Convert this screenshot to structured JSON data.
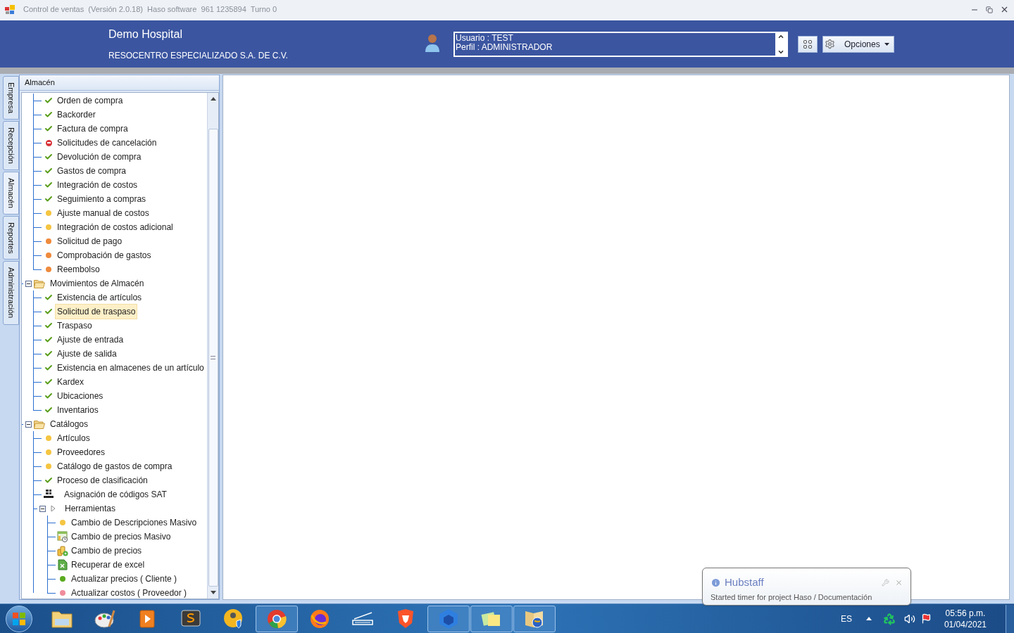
{
  "window": {
    "title": "Control de ventas  (Versión 2.0.18)  Haso software  961 1235894  Turno 0"
  },
  "header": {
    "company": "Demo Hospital",
    "subtitle": "RESOCENTRO ESPECIALIZADO S.A. DE C.V.",
    "user_lines": [
      "Usuario : TEST",
      "Perfil : ADMINISTRADOR"
    ],
    "options_button": "Opciones"
  },
  "side_tabs": [
    {
      "label": "Empresa",
      "selected": false
    },
    {
      "label": "Recepción",
      "selected": false
    },
    {
      "label": "Almacén",
      "selected": true
    },
    {
      "label": "Reportes",
      "selected": false
    },
    {
      "label": "Administración",
      "selected": false
    }
  ],
  "panel": {
    "title": "Almacén",
    "tree": [
      {
        "kind": "continued",
        "children": [
          {
            "label": "Orden de compra",
            "kind": "check",
            "selected": false
          },
          {
            "label": "Backorder",
            "kind": "check",
            "selected": false
          },
          {
            "label": "Factura de compra",
            "kind": "check",
            "selected": false
          },
          {
            "label": "Solicitudes de cancelación",
            "kind": "blocked",
            "selected": false
          },
          {
            "label": "Devolución de compra",
            "kind": "check",
            "selected": false
          },
          {
            "label": "Gastos de compra",
            "kind": "check",
            "selected": false
          },
          {
            "label": "Integración de costos",
            "kind": "check",
            "selected": false
          },
          {
            "label": "Seguimiento a compras",
            "kind": "check",
            "selected": false
          },
          {
            "label": "Ajuste manual de costos",
            "kind": "dot",
            "color": "#f5c542",
            "selected": false
          },
          {
            "label": "Integración de costos adicional",
            "kind": "dot",
            "color": "#f5c542",
            "selected": false
          },
          {
            "label": "Solicitud de pago",
            "kind": "dot",
            "color": "#ef8a3c",
            "selected": false
          },
          {
            "label": "Comprobación de gastos",
            "kind": "dot",
            "color": "#ef8a3c",
            "selected": false
          },
          {
            "label": "Reembolso",
            "kind": "dot",
            "color": "#ef8a3c",
            "selected": false
          }
        ]
      },
      {
        "kind": "folder",
        "label": "Movimientos de Almacén",
        "expanded": true,
        "children": [
          {
            "label": "Existencia de artículos",
            "kind": "check",
            "selected": false
          },
          {
            "label": "Solicitud de traspaso",
            "kind": "check",
            "selected": true
          },
          {
            "label": "Traspaso",
            "kind": "check",
            "selected": false
          },
          {
            "label": "Ajuste de entrada",
            "kind": "check",
            "selected": false
          },
          {
            "label": "Ajuste de salida",
            "kind": "check",
            "selected": false
          },
          {
            "label": "Existencia en almacenes de un artículo",
            "kind": "check",
            "selected": false
          },
          {
            "label": "Kardex",
            "kind": "check",
            "selected": false
          },
          {
            "label": "Ubicaciones",
            "kind": "check",
            "selected": false
          },
          {
            "label": "Inventarios",
            "kind": "check",
            "selected": false
          }
        ]
      },
      {
        "kind": "folder",
        "label": "Catálogos",
        "expanded": true,
        "children": [
          {
            "label": "Artículos",
            "kind": "dot",
            "color": "#f5c542",
            "selected": false
          },
          {
            "label": "Proveedores",
            "kind": "dot",
            "color": "#f5c542",
            "selected": false
          },
          {
            "label": "Catálogo de gastos de compra",
            "kind": "dot",
            "color": "#f5c542",
            "selected": false
          },
          {
            "label": "Proceso de clasificación",
            "kind": "check",
            "selected": false
          },
          {
            "label": "Asignación de códigos SAT",
            "kind": "sat",
            "selected": false
          },
          {
            "label": "Herramientas",
            "kind": "arrow",
            "expanded": true,
            "selected": false,
            "children": [
              {
                "label": "Cambio de Descripciones Masivo",
                "kind": "dot",
                "color": "#f5c542",
                "selected": false
              },
              {
                "label": "Cambio de precios Masivo",
                "kind": "calendar",
                "selected": false
              },
              {
                "label": "Cambio de precios",
                "kind": "coins",
                "selected": false
              },
              {
                "label": "Recuperar de excel",
                "kind": "sheet",
                "selected": false
              },
              {
                "label": "Actualizar precios ( Cliente )",
                "kind": "dot",
                "color": "#5aaa1e",
                "selected": false
              },
              {
                "label": "Actualizar costos ( Proveedor )",
                "kind": "dot",
                "color": "#f08c9c",
                "selected": false
              }
            ]
          }
        ]
      }
    ]
  },
  "notification": {
    "title": "Hubstaff",
    "message": "Started timer for project Haso / Documentación"
  },
  "taskbar": {
    "apps": [
      {
        "kind": "folder",
        "open": false
      },
      {
        "kind": "paint",
        "open": false
      },
      {
        "kind": "player",
        "open": false
      },
      {
        "kind": "editor",
        "open": false
      },
      {
        "kind": "admin",
        "open": false
      },
      {
        "kind": "browser",
        "open": true
      },
      {
        "kind": "fox",
        "open": false
      },
      {
        "kind": "scanner",
        "open": false
      },
      {
        "kind": "lion",
        "open": false
      },
      {
        "kind": "hex",
        "open": true
      },
      {
        "kind": "notes",
        "open": true
      },
      {
        "kind": "globe",
        "open": true
      }
    ],
    "language": "ES",
    "time": "05:56 p.m.",
    "date": "01/04/2021"
  }
}
